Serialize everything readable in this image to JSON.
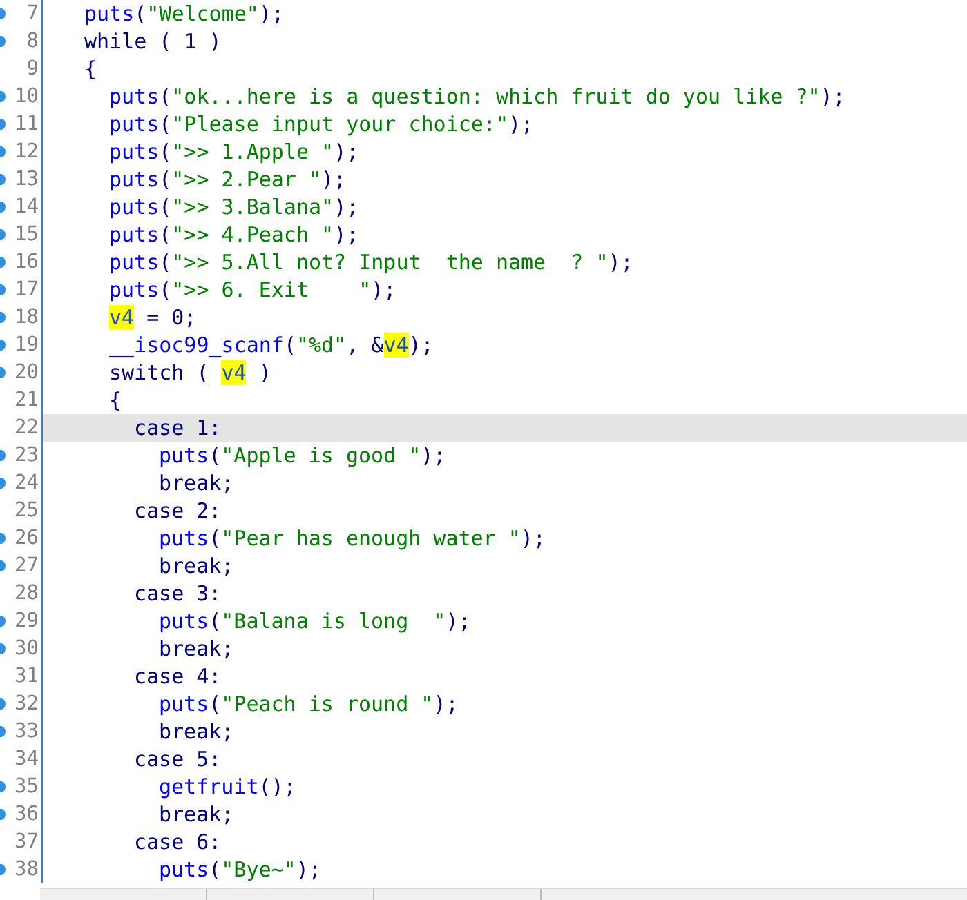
{
  "editor": {
    "lines": [
      {
        "number": "7",
        "breakpoint": true,
        "selected": false,
        "tokens": [
          {
            "kind": "call",
            "text": "puts"
          },
          {
            "kind": "plain",
            "text": "("
          },
          {
            "kind": "string",
            "text": "\"Welcome\""
          },
          {
            "kind": "plain",
            "text": ");"
          }
        ]
      },
      {
        "number": "8",
        "breakpoint": true,
        "selected": false,
        "tokens": [
          {
            "kind": "plain",
            "text": "while ( 1 )"
          }
        ]
      },
      {
        "number": "9",
        "breakpoint": false,
        "selected": false,
        "tokens": [
          {
            "kind": "plain",
            "text": "{"
          }
        ],
        "children": [
          {
            "number": "10",
            "breakpoint": true,
            "selected": false,
            "tokens": [
              {
                "kind": "call",
                "text": "puts"
              },
              {
                "kind": "plain",
                "text": "("
              },
              {
                "kind": "string",
                "text": "\"ok...here is a question: which fruit do you like ?\""
              },
              {
                "kind": "plain",
                "text": ");"
              }
            ]
          },
          {
            "number": "11",
            "breakpoint": true,
            "selected": false,
            "tokens": [
              {
                "kind": "call",
                "text": "puts"
              },
              {
                "kind": "plain",
                "text": "("
              },
              {
                "kind": "string",
                "text": "\"Please input your choice:\""
              },
              {
                "kind": "plain",
                "text": ");"
              }
            ]
          },
          {
            "number": "12",
            "breakpoint": true,
            "selected": false,
            "tokens": [
              {
                "kind": "call",
                "text": "puts"
              },
              {
                "kind": "plain",
                "text": "("
              },
              {
                "kind": "string",
                "text": "\">> 1.Apple \""
              },
              {
                "kind": "plain",
                "text": ");"
              }
            ]
          },
          {
            "number": "13",
            "breakpoint": true,
            "selected": false,
            "tokens": [
              {
                "kind": "call",
                "text": "puts"
              },
              {
                "kind": "plain",
                "text": "("
              },
              {
                "kind": "string",
                "text": "\">> 2.Pear \""
              },
              {
                "kind": "plain",
                "text": ");"
              }
            ]
          },
          {
            "number": "14",
            "breakpoint": true,
            "selected": false,
            "tokens": [
              {
                "kind": "call",
                "text": "puts"
              },
              {
                "kind": "plain",
                "text": "("
              },
              {
                "kind": "string",
                "text": "\">> 3.Balana\""
              },
              {
                "kind": "plain",
                "text": ");"
              }
            ]
          },
          {
            "number": "15",
            "breakpoint": true,
            "selected": false,
            "tokens": [
              {
                "kind": "call",
                "text": "puts"
              },
              {
                "kind": "plain",
                "text": "("
              },
              {
                "kind": "string",
                "text": "\">> 4.Peach \""
              },
              {
                "kind": "plain",
                "text": ");"
              }
            ]
          },
          {
            "number": "16",
            "breakpoint": true,
            "selected": false,
            "tokens": [
              {
                "kind": "call",
                "text": "puts"
              },
              {
                "kind": "plain",
                "text": "("
              },
              {
                "kind": "string",
                "text": "\">> 5.All not? Input  the name  ? \""
              },
              {
                "kind": "plain",
                "text": ");"
              }
            ]
          },
          {
            "number": "17",
            "breakpoint": true,
            "selected": false,
            "tokens": [
              {
                "kind": "call",
                "text": "puts"
              },
              {
                "kind": "plain",
                "text": "("
              },
              {
                "kind": "string",
                "text": "\">> 6. Exit    \""
              },
              {
                "kind": "plain",
                "text": ");"
              }
            ]
          },
          {
            "number": "18",
            "breakpoint": true,
            "selected": false,
            "tokens": [
              {
                "kind": "highlight",
                "text": "v4"
              },
              {
                "kind": "plain",
                "text": " = 0;"
              }
            ]
          },
          {
            "number": "19",
            "breakpoint": true,
            "selected": false,
            "tokens": [
              {
                "kind": "call",
                "text": "__isoc99_scanf"
              },
              {
                "kind": "plain",
                "text": "("
              },
              {
                "kind": "string",
                "text": "\"%d\""
              },
              {
                "kind": "plain",
                "text": ", &"
              },
              {
                "kind": "highlight",
                "text": "v4"
              },
              {
                "kind": "plain",
                "text": ");"
              }
            ]
          },
          {
            "number": "20",
            "breakpoint": true,
            "selected": false,
            "tokens": [
              {
                "kind": "plain",
                "text": "switch ( "
              },
              {
                "kind": "highlight",
                "text": "v4"
              },
              {
                "kind": "plain",
                "text": " )"
              }
            ]
          },
          {
            "number": "21",
            "breakpoint": false,
            "selected": false,
            "tokens": [
              {
                "kind": "plain",
                "text": "{"
              }
            ],
            "children": [
              {
                "number": "22",
                "breakpoint": false,
                "selected": true,
                "tokens": [
                  {
                    "kind": "plain",
                    "text": "case 1:"
                  }
                ],
                "children": [
                  {
                    "number": "23",
                    "breakpoint": true,
                    "selected": false,
                    "tokens": [
                      {
                        "kind": "call",
                        "text": "puts"
                      },
                      {
                        "kind": "plain",
                        "text": "("
                      },
                      {
                        "kind": "string",
                        "text": "\"Apple is good \""
                      },
                      {
                        "kind": "plain",
                        "text": ");"
                      }
                    ]
                  },
                  {
                    "number": "24",
                    "breakpoint": true,
                    "selected": false,
                    "tokens": [
                      {
                        "kind": "plain",
                        "text": "break;"
                      }
                    ]
                  }
                ]
              },
              {
                "number": "25",
                "breakpoint": false,
                "selected": false,
                "tokens": [
                  {
                    "kind": "plain",
                    "text": "case 2:"
                  }
                ],
                "children": [
                  {
                    "number": "26",
                    "breakpoint": true,
                    "selected": false,
                    "tokens": [
                      {
                        "kind": "call",
                        "text": "puts"
                      },
                      {
                        "kind": "plain",
                        "text": "("
                      },
                      {
                        "kind": "string",
                        "text": "\"Pear has enough water \""
                      },
                      {
                        "kind": "plain",
                        "text": ");"
                      }
                    ]
                  },
                  {
                    "number": "27",
                    "breakpoint": true,
                    "selected": false,
                    "tokens": [
                      {
                        "kind": "plain",
                        "text": "break;"
                      }
                    ]
                  }
                ]
              },
              {
                "number": "28",
                "breakpoint": false,
                "selected": false,
                "tokens": [
                  {
                    "kind": "plain",
                    "text": "case 3:"
                  }
                ],
                "children": [
                  {
                    "number": "29",
                    "breakpoint": true,
                    "selected": false,
                    "tokens": [
                      {
                        "kind": "call",
                        "text": "puts"
                      },
                      {
                        "kind": "plain",
                        "text": "("
                      },
                      {
                        "kind": "string",
                        "text": "\"Balana is long  \""
                      },
                      {
                        "kind": "plain",
                        "text": ");"
                      }
                    ]
                  },
                  {
                    "number": "30",
                    "breakpoint": true,
                    "selected": false,
                    "tokens": [
                      {
                        "kind": "plain",
                        "text": "break;"
                      }
                    ]
                  }
                ]
              },
              {
                "number": "31",
                "breakpoint": false,
                "selected": false,
                "tokens": [
                  {
                    "kind": "plain",
                    "text": "case 4:"
                  }
                ],
                "children": [
                  {
                    "number": "32",
                    "breakpoint": true,
                    "selected": false,
                    "tokens": [
                      {
                        "kind": "call",
                        "text": "puts"
                      },
                      {
                        "kind": "plain",
                        "text": "("
                      },
                      {
                        "kind": "string",
                        "text": "\"Peach is round \""
                      },
                      {
                        "kind": "plain",
                        "text": ");"
                      }
                    ]
                  },
                  {
                    "number": "33",
                    "breakpoint": true,
                    "selected": false,
                    "tokens": [
                      {
                        "kind": "plain",
                        "text": "break;"
                      }
                    ]
                  }
                ]
              },
              {
                "number": "34",
                "breakpoint": false,
                "selected": false,
                "tokens": [
                  {
                    "kind": "plain",
                    "text": "case 5:"
                  }
                ],
                "children": [
                  {
                    "number": "35",
                    "breakpoint": true,
                    "selected": false,
                    "tokens": [
                      {
                        "kind": "call",
                        "text": "getfruit"
                      },
                      {
                        "kind": "plain",
                        "text": "();"
                      }
                    ]
                  },
                  {
                    "number": "36",
                    "breakpoint": true,
                    "selected": false,
                    "tokens": [
                      {
                        "kind": "plain",
                        "text": "break;"
                      }
                    ]
                  }
                ]
              },
              {
                "number": "37",
                "breakpoint": false,
                "selected": false,
                "tokens": [
                  {
                    "kind": "plain",
                    "text": "case 6:"
                  }
                ],
                "children": [
                  {
                    "number": "38",
                    "breakpoint": true,
                    "selected": false,
                    "tokens": [
                      {
                        "kind": "call",
                        "text": "puts"
                      },
                      {
                        "kind": "plain",
                        "text": "("
                      },
                      {
                        "kind": "string",
                        "text": "\"Bye~\""
                      },
                      {
                        "kind": "plain",
                        "text": ");"
                      }
                    ]
                  }
                ]
              }
            ]
          }
        ]
      }
    ]
  }
}
